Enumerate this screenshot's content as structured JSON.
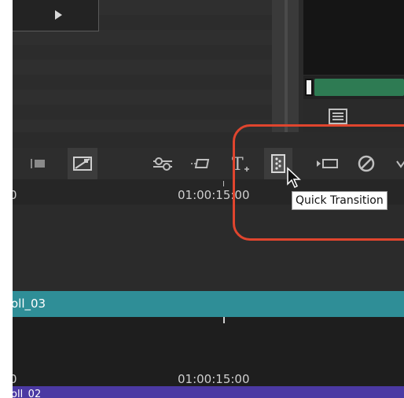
{
  "toolbar": {
    "items": [
      {
        "name": "clip-icon"
      },
      {
        "name": "dynamic-zoom-icon"
      },
      {
        "name": "sliders-icon"
      },
      {
        "name": "slate-icon"
      },
      {
        "name": "text-plus-icon"
      },
      {
        "name": "quick-transition-icon"
      },
      {
        "name": "insert-clip-icon"
      },
      {
        "name": "disable-icon"
      }
    ]
  },
  "ruler": {
    "left_edge": "0",
    "timecode": "01:00:15:00"
  },
  "track": {
    "name": "oll_03"
  },
  "track_ruler": {
    "left_edge": "0",
    "timecode": "01:00:15:00"
  },
  "bottom_track": {
    "name": "oll_02"
  },
  "tooltip": {
    "text": "Quick Transition"
  },
  "colors": {
    "highlight": "#e0452e",
    "track_header": "#2f8e97",
    "bottom_track": "#4b39a3",
    "scrub_bar": "#2e7b53"
  }
}
